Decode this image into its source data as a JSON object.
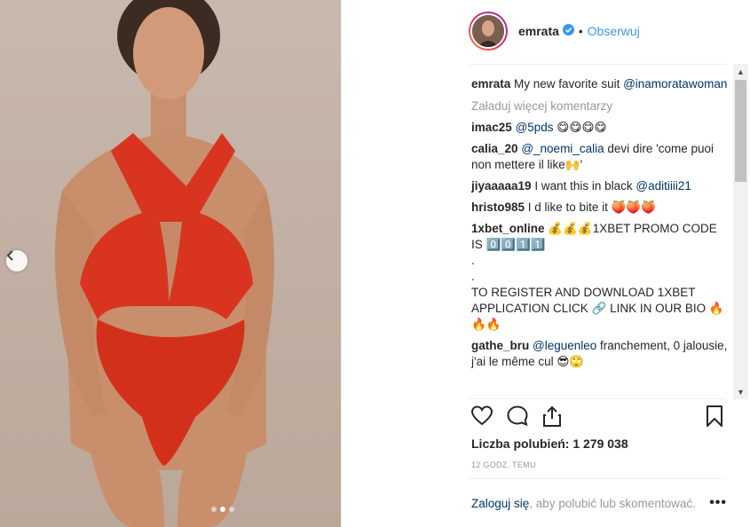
{
  "post": {
    "username": "emrata",
    "separator": "•",
    "follow_label": "Obserwuj",
    "caption_user": "emrata",
    "caption_text": " My new favorite suit ",
    "caption_mention": "@inamoratawoman",
    "load_more": "Załaduj więcej komentarzy",
    "likes_label": "Liczba polubień: 1 279 038",
    "timestamp": "12 GODZ. TEMU",
    "login_link": "Zaloguj się",
    "login_rest": ", aby polubić lub skomentować.",
    "more_label": "•••"
  },
  "comments": [
    {
      "user": "imac25",
      "mention": "@5pds",
      "text": " 😋😋😋😋"
    },
    {
      "user": "calia_20",
      "mention": "@_noemi_calia",
      "text": " devi dire 'come puoi non mettere il like🙌'"
    },
    {
      "user": "jiyaaaaa19",
      "mention": "",
      "text": " I want this in black ",
      "mention_after": "@aditiiii21"
    },
    {
      "user": "hristo985",
      "mention": "",
      "text": " I d like to bite it 🍑🍑🍑"
    },
    {
      "user": "1xbet_online",
      "mention": "",
      "text": " 💰💰💰1XBET  PROMO CODE IS 0️⃣0️⃣1️⃣1️⃣\n.\n.\nTO  REGISTER AND  DOWNLOAD  1XBET  APPLICATION CLICK 🔗 LINK  IN OUR BIO 🔥🔥🔥"
    },
    {
      "user": "gathe_bru",
      "mention": "@leguenleo",
      "text": " franchement, 0 jalousie, j'ai le même cul 😎🙄"
    }
  ],
  "icons": {
    "verified": "verified-badge-icon",
    "like": "heart-icon",
    "comment": "comment-icon",
    "share": "share-icon",
    "save": "bookmark-icon",
    "prev": "chevron-left-icon",
    "next": "chevron-right-icon"
  },
  "colors": {
    "accent": "#3897f0",
    "mention": "#003569",
    "muted": "#999999",
    "suit": "#d8341f"
  }
}
